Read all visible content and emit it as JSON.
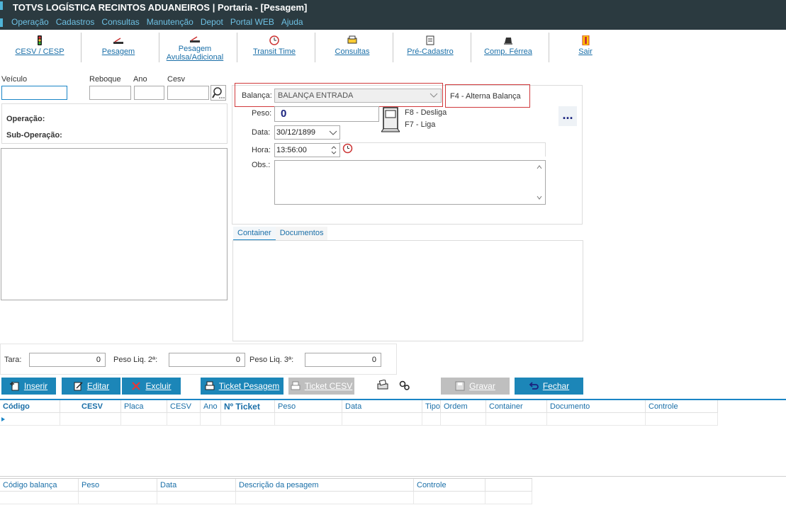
{
  "window": {
    "title": "TOTVS LOGÍSTICA RECINTOS ADUANEIROS | Portaria - [Pesagem]"
  },
  "menu": [
    "Operação",
    "Cadastros",
    "Consultas",
    "Manutenção",
    "Depot",
    "Portal WEB",
    "Ajuda"
  ],
  "toolbar": {
    "cesv": "CESV / CESP",
    "pesagem": "Pesagem",
    "pesagem_avulsa_1": "Pesagem",
    "pesagem_avulsa_2": "Avulsa/Adicional",
    "transit": "Transit Time",
    "consultas": "Consultas",
    "precadastro": "Pré-Cadastro",
    "ferrea": "Comp. Férrea",
    "sair": "Sair"
  },
  "left": {
    "veiculo_label": "Veículo",
    "reboque_label": "Reboque",
    "ano_label": "Ano",
    "cesv_label": "Cesv",
    "operacao_label": "Operação:",
    "suboperacao_label": "Sub-Operação:"
  },
  "balanca": {
    "label": "Balança:",
    "value": "BALANÇA ENTRADA",
    "alterna": "F4 - Alterna Balança",
    "peso_label": "Peso:",
    "peso_value": "0",
    "desliga": "F8 - Desliga",
    "liga": "F7 - Liga",
    "data_label": "Data:",
    "data_value": "30/12/1899",
    "hora_label": "Hora:",
    "hora_value": "13:56:00",
    "obs_label": "Obs.:",
    "more": "..."
  },
  "tabs": [
    "Container",
    "Documentos"
  ],
  "totals": {
    "tara_label": "Tara:",
    "tara_value": "0",
    "liq2_label": "Peso Liq. 2ª:",
    "liq2_value": "0",
    "liq3_label": "Peso Liq. 3ª:",
    "liq3_value": "0"
  },
  "buttons": {
    "inserir": "Inserir",
    "editar": "Editar",
    "excluir": "Excluir",
    "ticket_pesagem": "Ticket Pesagem",
    "ticket_cesv": "Ticket CESV",
    "gravar": "Gravar",
    "fechar": "Fechar"
  },
  "grid1": {
    "columns": [
      "Código",
      "CESV",
      "Placa",
      "CESV",
      "Ano",
      "Nº Ticket",
      "Peso",
      "Data",
      "Tipo",
      "Ordem",
      "Container",
      "Documento",
      "Controle"
    ]
  },
  "grid2": {
    "columns": [
      "Código balança",
      "Peso",
      "Data",
      "Descrição da pesagem",
      "Controle",
      ""
    ]
  },
  "colors": {
    "titlebar": "#2b3a40",
    "accent": "#1c86b8",
    "menu_text": "#6ec1e4",
    "highlight_border": "#d0383b",
    "disabled": "#bfbfbf"
  }
}
